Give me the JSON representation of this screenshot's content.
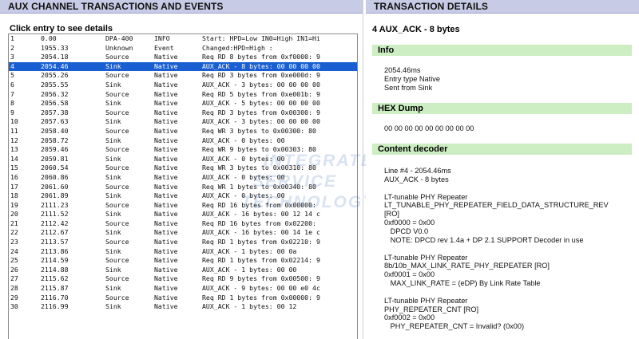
{
  "left_panel": {
    "title": "AUX CHANNEL TRANSACTIONS AND EVENTS",
    "hint": "Click entry to see details",
    "selected_index": 3,
    "rows": [
      [
        "1",
        "0.00",
        "DPA-400",
        "INFO",
        "Start: HPD=Low IN0=High IN1=Hi"
      ],
      [
        "2",
        "1955.33",
        "Unknown",
        "Event",
        "Changed:HPD=High :"
      ],
      [
        "3",
        "2054.18",
        "Source",
        "Native",
        "Req RD 8 bytes from 0xf0000: 9"
      ],
      [
        "4",
        "2054.46",
        "Sink",
        "Native",
        "AUX_ACK - 8 bytes: 00 00 00 00"
      ],
      [
        "5",
        "2055.26",
        "Source",
        "Native",
        "Req RD 3 bytes from 0xe000d: 9"
      ],
      [
        "6",
        "2055.55",
        "Sink",
        "Native",
        "AUX_ACK - 3 bytes: 00 00 00 00"
      ],
      [
        "7",
        "2056.32",
        "Source",
        "Native",
        "Req RD 5 bytes from 0xe001b: 9"
      ],
      [
        "8",
        "2056.58",
        "Sink",
        "Native",
        "AUX_ACK - 5 bytes: 00 00 00 00"
      ],
      [
        "9",
        "2057.38",
        "Source",
        "Native",
        "Req RD 3 bytes from 0x00300: 9"
      ],
      [
        "10",
        "2057.63",
        "Sink",
        "Native",
        "AUX_ACK - 3 bytes: 00 00 00 00"
      ],
      [
        "11",
        "2058.40",
        "Source",
        "Native",
        "Req WR 3 bytes to 0x00300: 80"
      ],
      [
        "12",
        "2058.72",
        "Sink",
        "Native",
        "AUX_ACK - 0 bytes: 00"
      ],
      [
        "13",
        "2059.46",
        "Source",
        "Native",
        "Req WR 9 bytes to 0x00303: 80"
      ],
      [
        "14",
        "2059.81",
        "Sink",
        "Native",
        "AUX_ACK - 0 bytes: 00"
      ],
      [
        "15",
        "2060.54",
        "Source",
        "Native",
        "Req WR 3 bytes to 0x00310: 80"
      ],
      [
        "16",
        "2060.86",
        "Sink",
        "Native",
        "AUX_ACK - 0 bytes: 00"
      ],
      [
        "17",
        "2061.60",
        "Source",
        "Native",
        "Req WR 1 bytes to 0x00340: 80"
      ],
      [
        "18",
        "2061.89",
        "Sink",
        "Native",
        "AUX_ACK - 0 bytes: 00"
      ],
      [
        "19",
        "2111.23",
        "Source",
        "Native",
        "Req RD 16 bytes from 0x00000:"
      ],
      [
        "20",
        "2111.52",
        "Sink",
        "Native",
        "AUX_ACK - 16 bytes: 00 12 14 c"
      ],
      [
        "21",
        "2112.42",
        "Source",
        "Native",
        "Req RD 16 bytes from 0x02200:"
      ],
      [
        "22",
        "2112.67",
        "Sink",
        "Native",
        "AUX_ACK - 16 bytes: 00 14 1e c"
      ],
      [
        "23",
        "2113.57",
        "Source",
        "Native",
        "Req RD 1 bytes from 0x02210: 9"
      ],
      [
        "24",
        "2113.86",
        "Sink",
        "Native",
        "AUX_ACK - 1 bytes: 00 0a"
      ],
      [
        "25",
        "2114.59",
        "Source",
        "Native",
        "Req RD 1 bytes from 0x02214: 9"
      ],
      [
        "26",
        "2114.88",
        "Sink",
        "Native",
        "AUX_ACK - 1 bytes: 00 00"
      ],
      [
        "27",
        "2115.62",
        "Source",
        "Native",
        "Req RD 9 bytes from 0x00500: 9"
      ],
      [
        "28",
        "2115.87",
        "Sink",
        "Native",
        "AUX_ACK - 9 bytes: 00 00 e0 4c"
      ],
      [
        "29",
        "2116.70",
        "Source",
        "Native",
        "Req RD 1 bytes from 0x00000: 9"
      ],
      [
        "30",
        "2116.99",
        "Sink",
        "Native",
        "AUX_ACK - 1 bytes: 00 12"
      ]
    ]
  },
  "watermark": {
    "lines": [
      "INTEGRATED",
      "SERVICE",
      "TECHNOLOGY"
    ]
  },
  "right_panel": {
    "title": "TRANSACTION DETAILS",
    "selected_title": "4 AUX_ACK - 8 bytes",
    "sections": {
      "info": "Info",
      "hex": "HEX Dump",
      "decoder": "Content decoder"
    },
    "info_lines": [
      "2054.46ms",
      "Entry type Native",
      "Sent from Sink"
    ],
    "hex_dump": "00 00 00 00 00 00 00 00 00",
    "decoder_lines": [
      "Line #4 - 2054.46ms",
      "AUX_ACK - 8 bytes",
      "",
      "LT-tunable PHY Repeater",
      "LT_TUNABLE_PHY_REPEATER_FIELD_DATA_STRUCTURE_REV",
      "[RO]",
      "0xf0000 = 0x00",
      "   DPCD V0.0",
      "   NOTE: DPCD rev 1.4a + DP 2.1 SUPPORT Decoder in use",
      "",
      "LT-tunable PHY Repeater",
      "8b/10b_MAX_LINK_RATE_PHY_REPEATER [RO]",
      "0xf0001 = 0x00",
      "   MAX_LINK_RATE = (eDP) By Link Rate Table",
      "",
      "LT-tunable PHY Repeater",
      "PHY_REPEATER_CNT [RO]",
      "0xf0002 = 0x00",
      "   PHY_REPEATER_CNT = Invalid? (0x00)"
    ]
  }
}
